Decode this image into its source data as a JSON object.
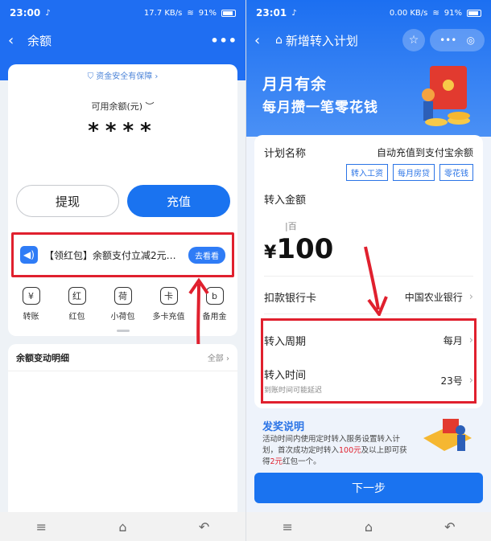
{
  "left": {
    "status": {
      "time": "23:00",
      "network": "17.7 KB/s",
      "battery": "91%"
    },
    "nav": {
      "back": "‹",
      "title": "余额",
      "more": "•••"
    },
    "security": "资金安全有保障 ›",
    "balance": {
      "label": "可用余额(元)",
      "hidden": "****"
    },
    "buttons": {
      "withdraw": "提现",
      "topup": "充值"
    },
    "promo": {
      "text": "【领红包】余额支付立减2元…",
      "cta": "去看看"
    },
    "funcs": [
      {
        "icon": "¥",
        "label": "转账"
      },
      {
        "icon": "红",
        "label": "红包"
      },
      {
        "icon": "荷",
        "label": "小荷包"
      },
      {
        "icon": "卡",
        "label": "多卡充值"
      },
      {
        "icon": "b",
        "label": "备用金"
      }
    ],
    "detail": {
      "title": "余额变动明细",
      "all": "全部 ›"
    },
    "sysnav": [
      "≡",
      "⌂",
      "↶"
    ]
  },
  "right": {
    "status": {
      "time": "23:01",
      "network": "0.00 KB/s",
      "battery": "91%"
    },
    "nav": {
      "back": "‹",
      "home": "⌂",
      "title": "新增转入计划"
    },
    "banner": {
      "line1": "月月有余",
      "line2": "每月攒一笔零花钱"
    },
    "plan": {
      "label": "计划名称",
      "value": "自动充值到支付宝余额",
      "tags": [
        "转入工资",
        "每月房贷",
        "零花钱"
      ]
    },
    "amount": {
      "label": "转入金额",
      "unit": "|百",
      "currency": "¥",
      "value": "100"
    },
    "bank": {
      "label": "扣款银行卡",
      "value": "中国农业银行"
    },
    "cycle": {
      "label": "转入周期",
      "value": "每月"
    },
    "time": {
      "label": "转入时间",
      "sub": "到账时间可能延迟",
      "value": "23号"
    },
    "prize": {
      "title": "发奖说明",
      "desc_a": "活动时间内使用定时转入服务设置转入计划，首次成功定时转入",
      "desc_hl1": "100元",
      "desc_b": "及以上即可获得",
      "desc_hl2": "2元",
      "desc_c": "红包一个。"
    },
    "next": "下一步",
    "sysnav": [
      "≡",
      "⌂",
      "↶"
    ]
  },
  "colors": {
    "accent": "#1a73f0",
    "highlight": "#e0202e"
  }
}
